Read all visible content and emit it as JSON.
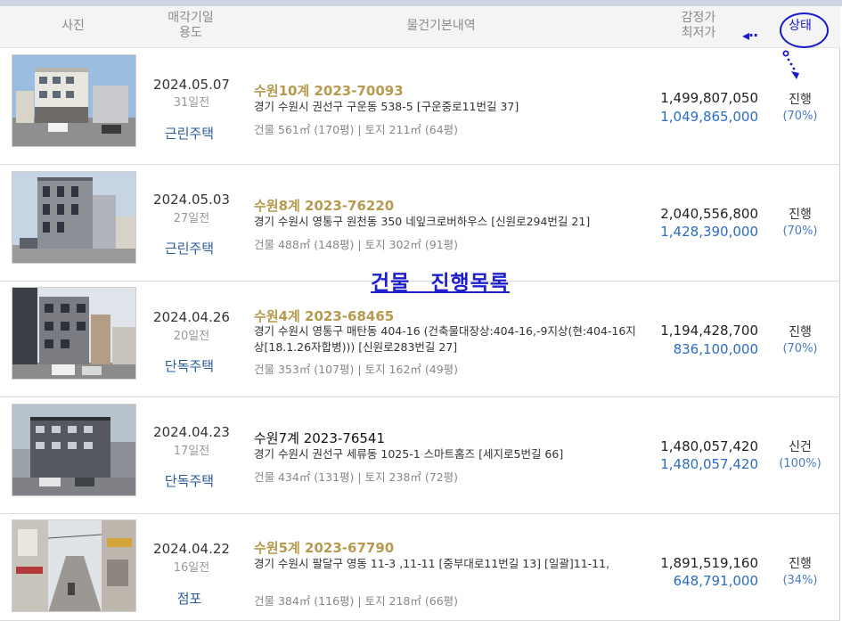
{
  "header": {
    "photo": "사진",
    "date_line1": "매각기일",
    "date_line2": "용도",
    "desc": "물건기본내역",
    "price_line1": "감정가",
    "price_line2": "최저가",
    "status": "상태"
  },
  "banner": "건물 진행목록",
  "rows": [
    {
      "date": "2024.05.07",
      "days": "31일전",
      "usage": "근린주택",
      "case": "수원10계 2023-70093",
      "case_style": "gold",
      "addr": "경기 수원시 권선구 구운동 538-5 [구운중로11번길 37]",
      "area": "건물 561㎡ (170평)   |   토지 211㎡ (64평)",
      "appraisal": "1,499,807,050",
      "minimum": "1,049,865,000",
      "status": "진행",
      "pct": "(70%)"
    },
    {
      "date": "2024.05.03",
      "days": "27일전",
      "usage": "근린주택",
      "case": "수원8계 2023-76220",
      "case_style": "gold",
      "addr": "경기 수원시 영통구 원천동 350 네잎크로버하우스 [신원로294번길 21]",
      "area": "건물 488㎡ (148평)   |   토지 302㎡ (91평)",
      "appraisal": "2,040,556,800",
      "minimum": "1,428,390,000",
      "status": "진행",
      "pct": "(70%)"
    },
    {
      "date": "2024.04.26",
      "days": "20일전",
      "usage": "단독주택",
      "case": "수원4계 2023-68465",
      "case_style": "gold",
      "addr": "경기 수원시 영통구 매탄동 404-16 (건축물대장상:404-16,-9지상(현:404-16지상[18.1.26자합병))) [신원로283번길 27]",
      "area": "건물 353㎡ (107평)   |   토지 162㎡ (49평)",
      "appraisal": "1,194,428,700",
      "minimum": "836,100,000",
      "status": "진행",
      "pct": "(70%)"
    },
    {
      "date": "2024.04.23",
      "days": "17일전",
      "usage": "단독주택",
      "case": "수원7계 2023-76541",
      "case_style": "black",
      "addr": "경기 수원시 권선구 세류동 1025-1 스마트홈즈 [세지로5번길 66]",
      "area": "건물 434㎡ (131평)   |   토지 238㎡ (72평)",
      "appraisal": "1,480,057,420",
      "minimum": "1,480,057,420",
      "status": "신건",
      "pct": "(100%)"
    },
    {
      "date": "2024.04.22",
      "days": "16일전",
      "usage": "점포",
      "case": "수원5계 2023-67790",
      "case_style": "gold",
      "addr": "경기 수원시 팔달구 영동 11-3 ,11-11 [중부대로11번길 13]  [일괄]11-11,",
      "area": "건물 384㎡ (116평)   |   토지 218㎡ (66평)",
      "appraisal": "1,891,519,160",
      "minimum": "648,791,000",
      "status": "진행",
      "pct": "(34%)"
    }
  ]
}
